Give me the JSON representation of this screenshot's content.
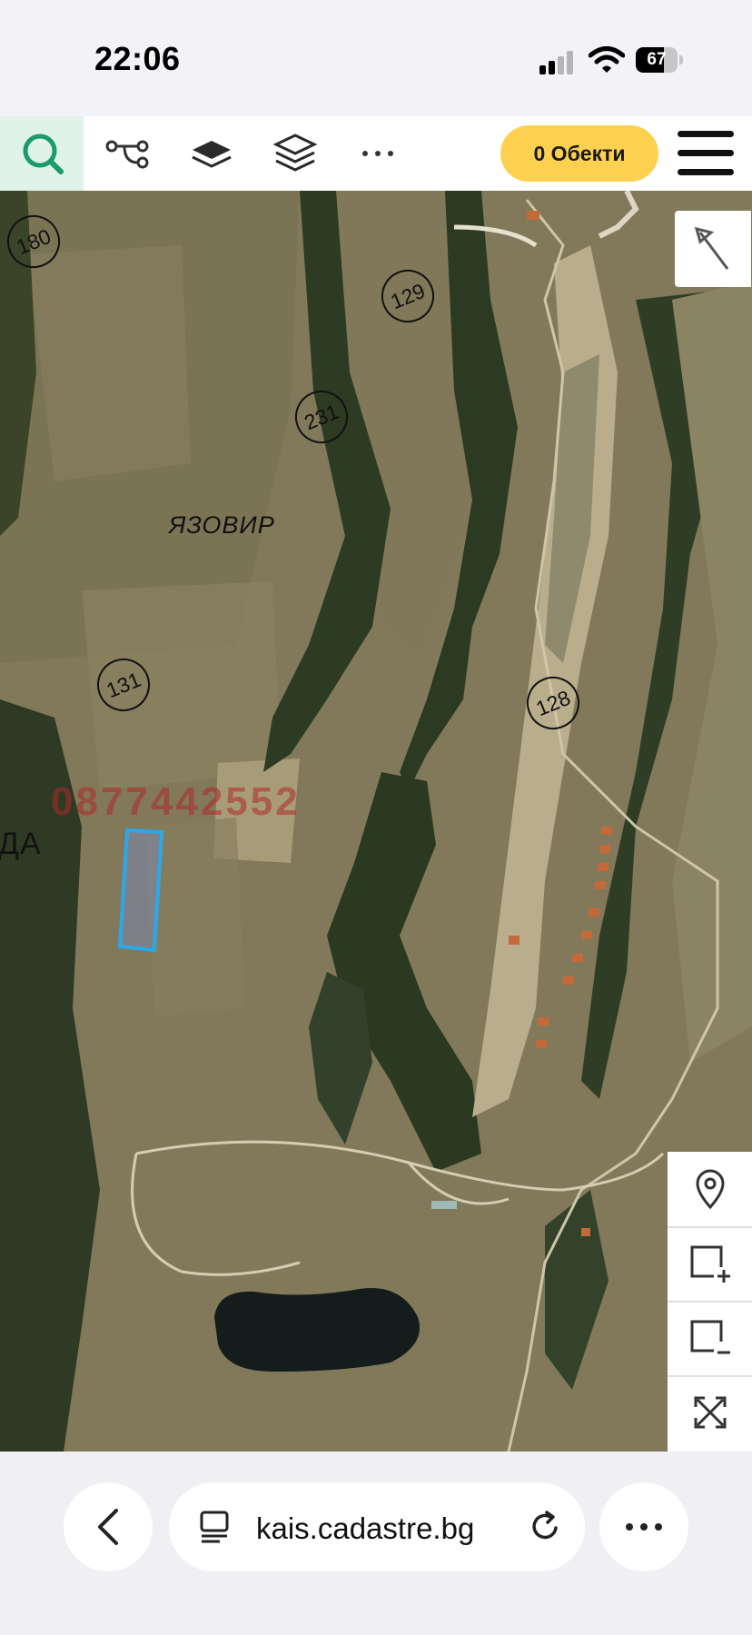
{
  "status_bar": {
    "time": "22:06",
    "battery_percent": "67",
    "battery_level": 0.67,
    "icons": [
      "signal-icon",
      "wifi-icon",
      "battery-icon"
    ]
  },
  "toolbar": {
    "icons": [
      "search-icon",
      "route-icon",
      "layer-icon",
      "layers-stack-icon",
      "more-dots-icon",
      "menu-icon"
    ],
    "objects_button_label": "0 Обекти",
    "accent_color": "#fdd14f",
    "search_bg_color": "#dff3ea",
    "search_icon_color": "#1b9a6a"
  },
  "map": {
    "parcel_numbers": [
      "180",
      "129",
      "231",
      "131",
      "128"
    ],
    "labels": {
      "reservoir": "ЯЗОВИР",
      "partial_left": "ДА"
    },
    "watermark": "0877442552",
    "selected_parcel_color": "#2aa8ea",
    "controls": [
      "north-arrow-icon",
      "location-pin-icon",
      "zoom-in-box-icon",
      "zoom-out-box-icon",
      "fullscreen-icon"
    ]
  },
  "browser": {
    "url": "kais.cadastre.bg",
    "icons": [
      "back-chevron-icon",
      "tab-icon",
      "reload-icon",
      "more-dots-icon"
    ]
  }
}
